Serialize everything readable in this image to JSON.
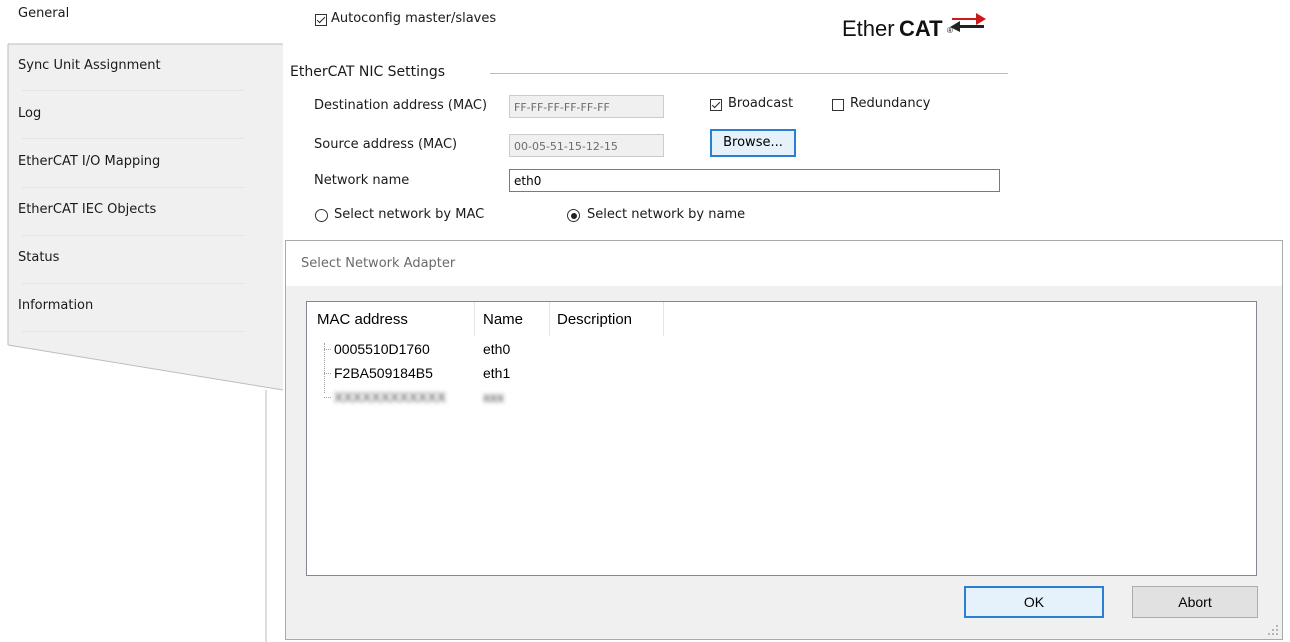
{
  "tabs": [
    {
      "label": "General"
    },
    {
      "label": "Sync Unit Assignment"
    },
    {
      "label": "Log"
    },
    {
      "label": "EtherCAT I/O Mapping"
    },
    {
      "label": "EtherCAT IEC Objects"
    },
    {
      "label": "Status"
    },
    {
      "label": "Information"
    }
  ],
  "general": {
    "autoconfig_label": "Autoconfig master/slaves",
    "autoconfig_checked": true,
    "logo": {
      "ether": "Ether",
      "cat": "CAT",
      "reg": "®"
    },
    "nic_group_title": "EtherCAT NIC Settings",
    "dest_label": "Destination address (MAC)",
    "dest_value": "FF-FF-FF-FF-FF-FF",
    "broadcast_label": "Broadcast",
    "broadcast_checked": true,
    "redundancy_label": "Redundancy",
    "redundancy_checked": false,
    "source_label": "Source address (MAC)",
    "source_value": "00-05-51-15-12-15",
    "browse_label": "Browse...",
    "network_name_label": "Network name",
    "network_name_value": "eth0",
    "select_by_mac_label": "Select network by MAC",
    "select_by_name_label": "Select network by name",
    "selected_mode": "name"
  },
  "dialog": {
    "title": "Select Network Adapter",
    "columns": [
      "MAC address",
      "Name",
      "Description"
    ],
    "rows": [
      {
        "mac": "0005510D1760",
        "name": "eth0",
        "description": ""
      },
      {
        "mac": "F2BA509184B5",
        "name": "eth1",
        "description": ""
      },
      {
        "mac": "XXXXXXXXXXXX",
        "name": "xxx",
        "description": "",
        "obscured": true
      }
    ],
    "ok_label": "OK",
    "abort_label": "Abort"
  },
  "colors": {
    "logo_red": "#cc1a1a",
    "focus_blue": "#2a7fd4",
    "dialog_bg": "#f0f0f0"
  }
}
